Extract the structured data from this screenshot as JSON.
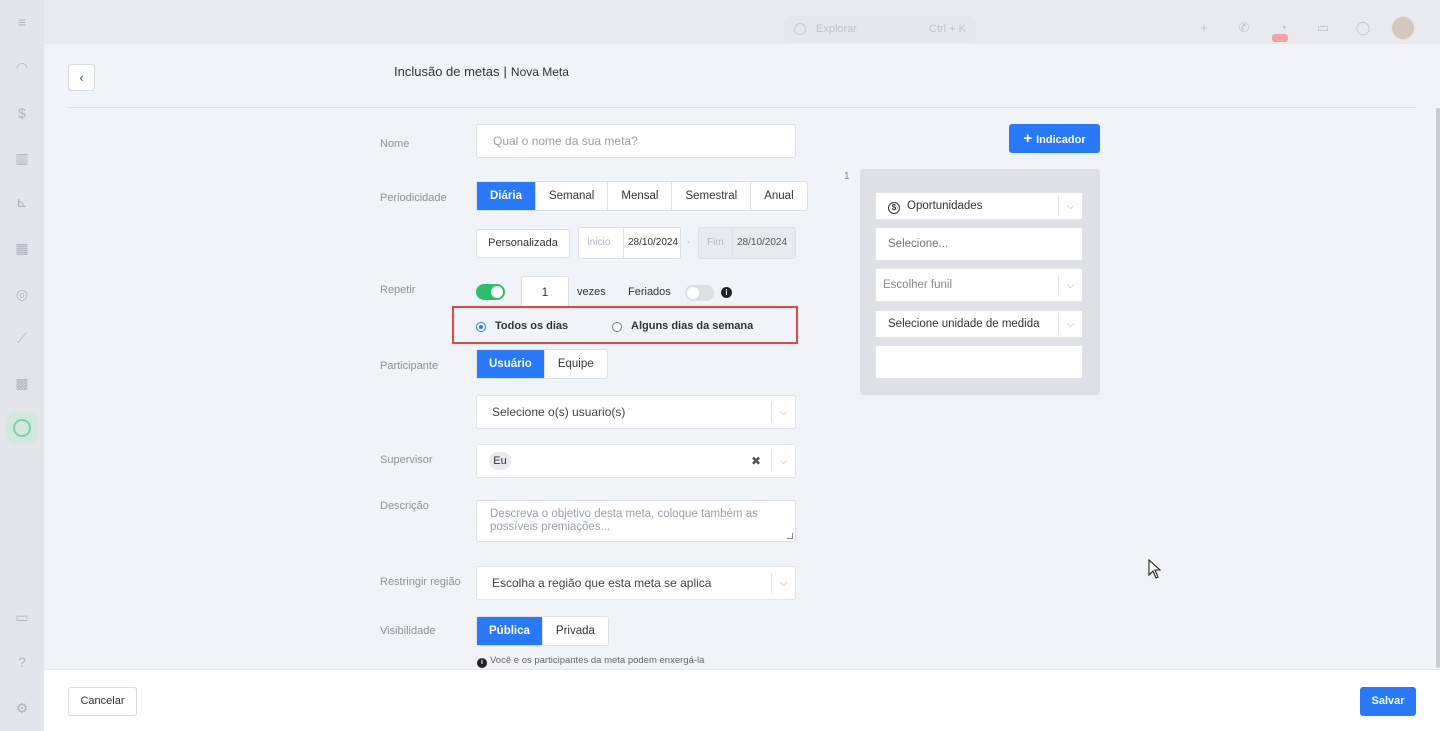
{
  "topbar": {
    "search_placeholder": "Explorar",
    "search_shortcut": "Ctrl + K",
    "icons": [
      "plus-icon",
      "phone-icon",
      "bell-icon",
      "inbox-icon",
      "check-circle-icon"
    ]
  },
  "modal": {
    "title": "Inclusão de metas",
    "separator": "|",
    "subtitle": "Nova Meta",
    "back_glyph": "‹"
  },
  "form": {
    "nome": {
      "label": "Nome",
      "placeholder": "Qual o nome da sua meta?"
    },
    "periodicidade": {
      "label": "Periodicidade",
      "options": [
        "Diária",
        "Semanal",
        "Mensal",
        "Semestral",
        "Anual"
      ],
      "selected": "Diária",
      "custom_label": "Personalizada",
      "inicio_label": "Inicio",
      "inicio_value": "28/10/2024",
      "dash": "-",
      "fim_label": "Fim",
      "fim_value": "28/10/2024"
    },
    "repetir": {
      "label": "Repetir",
      "enabled": true,
      "count": "1",
      "unit": "vezes",
      "feriados_label": "Feriados",
      "feriados_enabled": false,
      "radio_todos": "Todos os dias",
      "radio_alguns": "Alguns dias da semana",
      "radio_selected": "Todos os dias"
    },
    "participante": {
      "label": "Participante",
      "options": [
        "Usuário",
        "Equipe"
      ],
      "selected": "Usuário",
      "select_placeholder": "Selecione o(s) usuario(s)"
    },
    "supervisor": {
      "label": "Supervisor",
      "chip": "Eu",
      "clear": "✖"
    },
    "descricao": {
      "label": "Descrição",
      "placeholder": "Descreva o objetivo desta meta, coloque também as possíveis premiações..."
    },
    "regiao": {
      "label": "Restringir região",
      "placeholder": "Escolha a região que esta meta se aplica"
    },
    "visibilidade": {
      "label": "Visibilidade",
      "options": [
        "Pública",
        "Privada"
      ],
      "selected": "Pública",
      "hint": "Você e os participantes da meta podem enxergá-la"
    }
  },
  "indicator": {
    "add_button": "Indicador",
    "add_glyph": "+",
    "number": "1",
    "type_value": "Oportunidades",
    "coin_glyph": "$",
    "select_placeholder": "Selecione...",
    "funnel_placeholder": "Escolher funil",
    "unit_placeholder": "Selecione unidade de medida",
    "value": ""
  },
  "footer": {
    "cancel": "Cancelar",
    "save": "Salvar"
  },
  "colors": {
    "primary": "#2979ff",
    "toggle_on": "#2bbf6a",
    "highlight": "#e04848"
  }
}
